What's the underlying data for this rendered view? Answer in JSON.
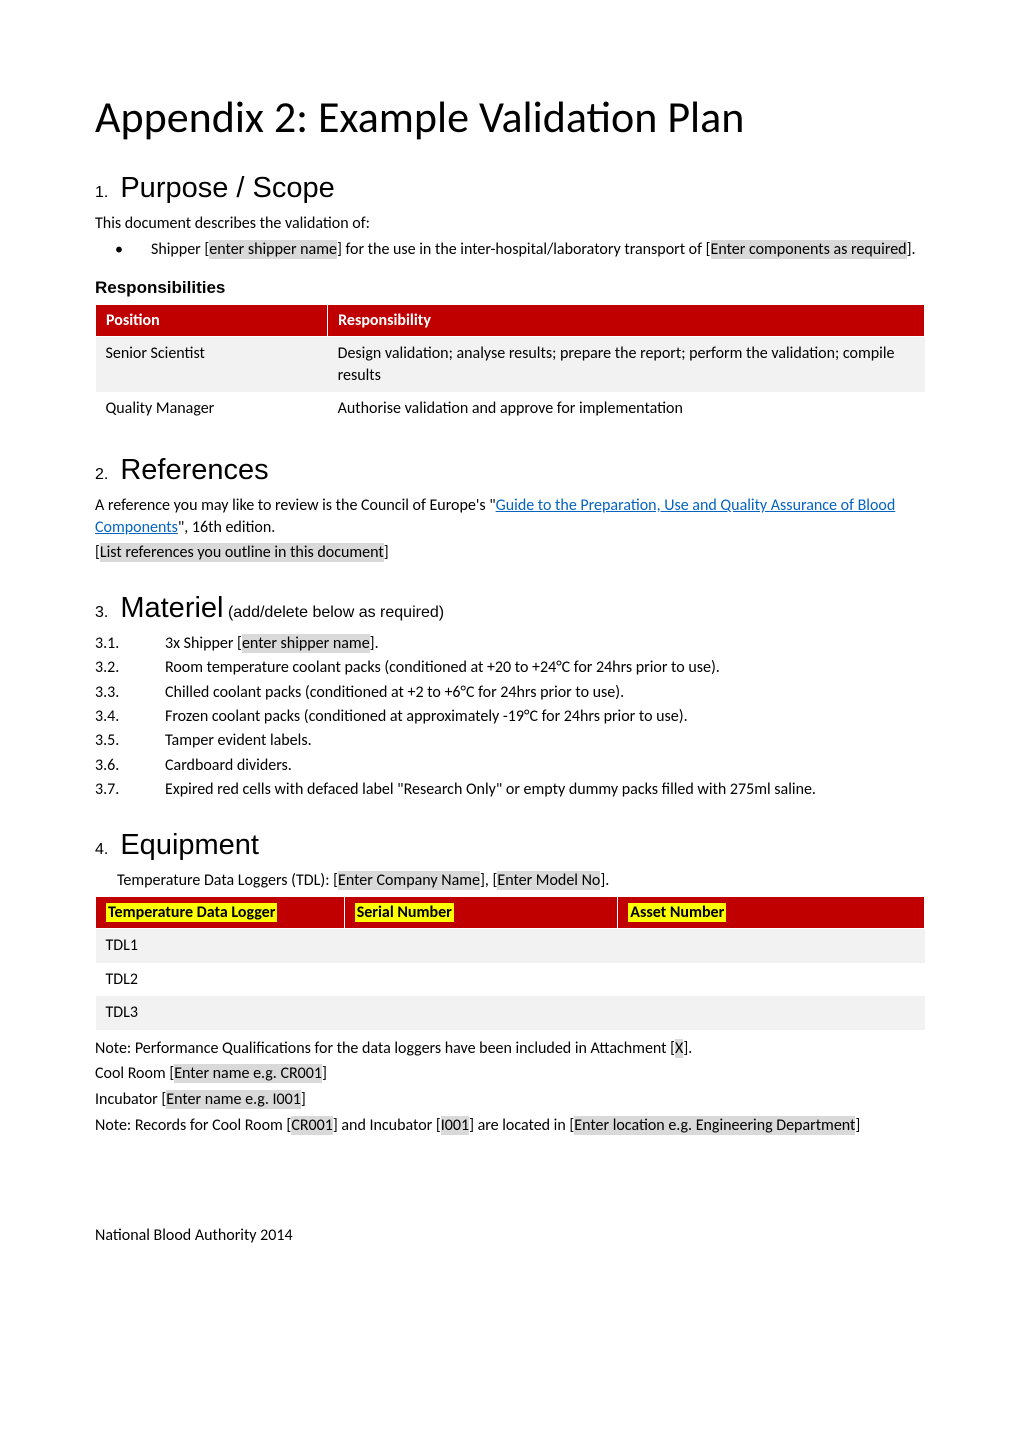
{
  "title": "Appendix 2: Example Validation Plan",
  "sec1": {
    "num": "1.",
    "heading": "Purpose / Scope",
    "intro": "This document describes the validation of:",
    "bullet_pre": "Shipper [",
    "bullet_ph1": "enter shipper name",
    "bullet_mid": "] for the use in the inter-hospital/laboratory transport of [",
    "bullet_ph2": "Enter components as required",
    "bullet_post": "]."
  },
  "resp": {
    "heading": "Responsibilities",
    "col1": "Position",
    "col2": "Responsibility",
    "rows": [
      {
        "pos": "Senior Scientist",
        "resp": "Design validation; analyse results; prepare the report; perform the validation; compile results"
      },
      {
        "pos": "Quality Manager",
        "resp": "Authorise validation and approve for implementation"
      }
    ]
  },
  "sec2": {
    "num": "2.",
    "heading": "References",
    "text_pre": "A reference you may like to review is the Council of Europe's \"",
    "link": "Guide to the Preparation, Use and Quality Assurance of Blood Components",
    "text_post": "\", 16th edition.",
    "note_pre": "[",
    "note_ph": "List references you outline in this document",
    "note_post": "]"
  },
  "sec3": {
    "num": "3.",
    "heading": "Materiel",
    "sub": " (add/delete below as required)",
    "items": {
      "i1_num": "3.1.",
      "i1_pre": "3x Shipper [",
      "i1_ph": "enter shipper name",
      "i1_post": "].",
      "i2_num": "3.2.",
      "i2": "Room temperature coolant packs (conditioned at +20 to +24°C for 24hrs prior to use).",
      "i3_num": "3.3.",
      "i3": "Chilled coolant packs (conditioned at +2 to +6°C for 24hrs prior to use).",
      "i4_num": "3.4.",
      "i4": "Frozen coolant packs (conditioned at approximately -19°C for 24hrs prior to use).",
      "i5_num": "3.5.",
      "i5": "Tamper evident labels.",
      "i6_num": "3.6.",
      "i6": "Cardboard dividers.",
      "i7_num": "3.7.",
      "i7": "Expired red cells with defaced label \"Research Only\" or empty dummy packs filled with 275ml saline."
    }
  },
  "sec4": {
    "num": "4.",
    "heading": "Equipment",
    "intro_pre": "Temperature Data Loggers (TDL): [",
    "intro_ph1": "Enter Company Name",
    "intro_mid": "], [",
    "intro_ph2": "Enter Model No",
    "intro_post": "].",
    "col1": "Temperature Data Logger",
    "col2": "Serial Number",
    "col3": "Asset Number",
    "rows": [
      {
        "name": "TDL1",
        "sn": "",
        "an": ""
      },
      {
        "name": "TDL2",
        "sn": "",
        "an": ""
      },
      {
        "name": "TDL3",
        "sn": "",
        "an": ""
      }
    ],
    "note1_pre": "Note: Performance Qualifications for the data loggers have been included in Attachment [",
    "note1_ph": "X",
    "note1_post": "].",
    "cool_pre": "Cool Room [",
    "cool_ph": "Enter name e.g. CR001",
    "cool_post": "]",
    "inc_pre": "Incubator [",
    "inc_ph": "Enter name e.g. I001",
    "inc_post": "]",
    "note2_pre": "Note: Records for Cool Room [",
    "note2_ph1": "CR001",
    "note2_mid1": "] and Incubator [",
    "note2_ph2": "I001",
    "note2_mid2": "] are located in [",
    "note2_ph3": "Enter location e.g. Engineering Department",
    "note2_post": "]"
  },
  "footer": "National Blood Authority 2014"
}
